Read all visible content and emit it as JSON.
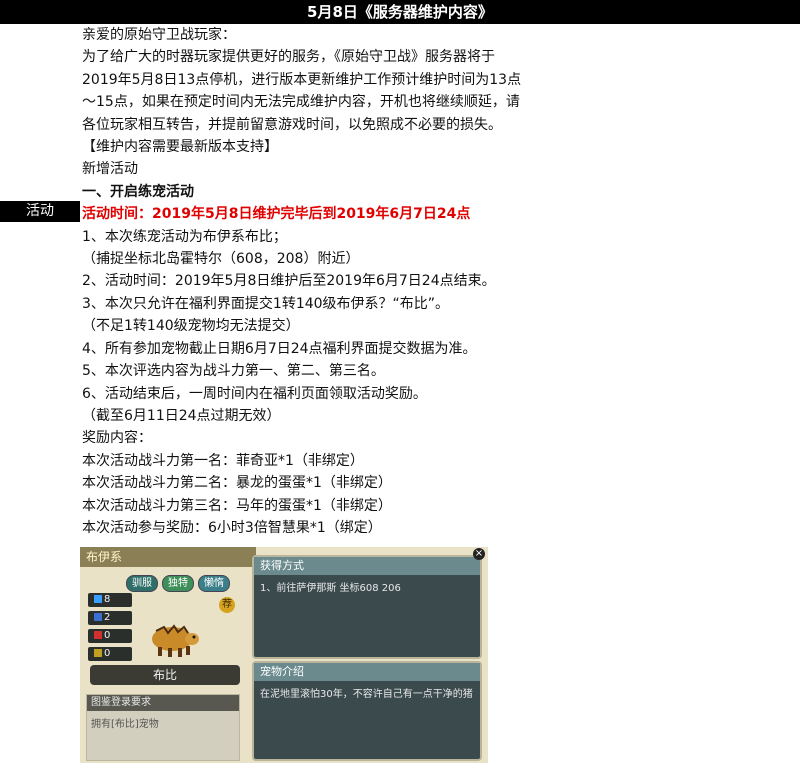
{
  "header": {
    "title": "5月8日《服务器维护内容》"
  },
  "sidebar": {
    "label": "活动"
  },
  "intro": {
    "greeting": "亲爱的原始守卫战玩家：",
    "paragraph": "为了给广大的时器玩家提供更好的服务，《原始守卫战》服务器将于2019年5月8日13点停机，进行版本更新维护工作预计维护时间为13点～15点，如果在预定时间内无法完成维护内容，开机也将继续顺延，请各位玩家相互转告，并提前留意游戏时间，以免照成不必要的损失。",
    "notice": "【维护内容需要最新版本支持】",
    "section": "新增活动"
  },
  "activity": {
    "title": "一、开启练宠活动",
    "time": "活动时间：2019年5月8日维护完毕后到2019年6月7日24点",
    "lines": [
      "1、本次练宠活动为布伊系布比；",
      "（捕捉坐标北岛霍特尔（608，208）附近）",
      "2、活动时间：2019年5月8日维护后至2019年6月7日24点结束。",
      "3、本次只允许在福利界面提交1转140级布伊系？“布比”。",
      "（不足1转140级宠物均无法提交）",
      "4、所有参加宠物截止日期6月7日24点福利界面提交数据为准。",
      "5、本次评选内容为战斗力第一、第二、第三名。",
      "6、活动结束后，一周时间内在福利页面领取活动奖励。",
      "（截至6月11日24点过期无效）",
      "奖励内容：",
      "本次活动战斗力第一名：菲奇亚*1（非绑定）",
      "本次活动战斗力第二名：暴龙的蛋蛋*1（非绑定）",
      "本次活动战斗力第三名：马年的蛋蛋*1（非绑定）",
      "本次活动参与奖励：6小时3倍智慧果*1（绑定）"
    ]
  },
  "game_panel": {
    "header": "布伊系",
    "buttons": [
      "驯服",
      "独特",
      "懒惰"
    ],
    "stats": [
      "8",
      "2",
      "0",
      "0"
    ],
    "stat_colors": [
      "#3aa0ff",
      "#3a70d0",
      "#d03030",
      "#c0a020"
    ],
    "seal": "荐",
    "pet_name": "布比",
    "req_title": "图鉴登录要求",
    "req_text": "拥有[布比]宠物",
    "obtain_title": "获得方式",
    "obtain_text": "1、前往萨伊那斯 坐标608 206",
    "intro_title": "宠物介绍",
    "intro_text": "在泥地里滚怕30年，不容许自己有一点干净的猪",
    "close": "×"
  }
}
